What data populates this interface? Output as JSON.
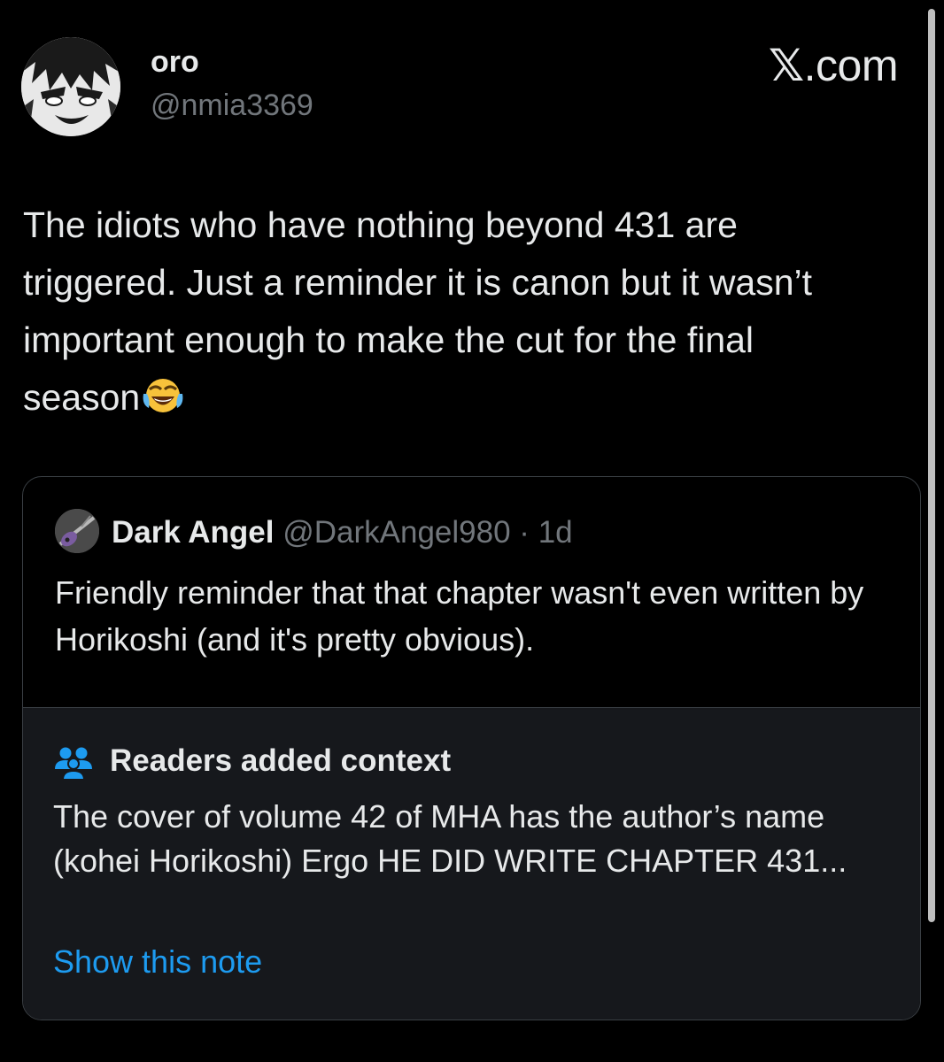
{
  "author": {
    "name": "oro",
    "handle": "@nmia3369",
    "avatar_icon": "manga-avatar"
  },
  "brand": {
    "symbol": "𝕏",
    "suffix": ".com"
  },
  "tweet": {
    "text": "The idiots who have nothing beyond 431 are\ntriggered. Just a reminder it is canon but it wasn’t\nimportant enough to make the cut for the final\nseason",
    "emoji": "face-with-tears-of-joy-icon"
  },
  "quoted_tweet": {
    "name": "Dark Angel",
    "handle": "@DarkAngel980",
    "separator": "·",
    "time": "1d",
    "text": "Friendly reminder that that chapter wasn't even written by Horikoshi (and it's pretty obvious)."
  },
  "community_note": {
    "icon": "people-icon",
    "title": "Readers added context",
    "body": "The cover of volume 42 of MHA has the author’s name (kohei Horikoshi) Ergo HE DID WRITE CHAPTER 431...",
    "link": "Show this note"
  },
  "colors": {
    "background": "#000000",
    "text": "#e7e9ea",
    "muted": "#71767b",
    "link": "#1d9bf0",
    "note_bg": "#16181c",
    "border": "#3a3f44"
  }
}
